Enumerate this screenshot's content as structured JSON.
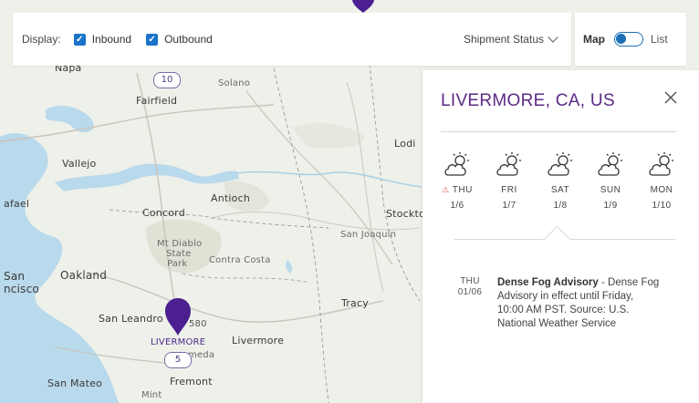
{
  "topbar": {
    "display_label": "Display:",
    "inbound_label": "Inbound",
    "outbound_label": "Outbound",
    "inbound_checked": true,
    "outbound_checked": true,
    "status_label": "Shipment Status"
  },
  "view_toggle": {
    "map_label": "Map",
    "list_label": "List",
    "active": "Map"
  },
  "map": {
    "places": {
      "napa": "Napa",
      "solano": "Solano",
      "fairfield": "Fairfield",
      "vallejo": "Vallejo",
      "rafael": "afael",
      "antioch": "Antioch",
      "concord": "Concord",
      "mt_diablo": "Mt Diablo",
      "state": "State",
      "park": "Park",
      "contra_costa": "Contra Costa",
      "oakland": "Oakland",
      "san": "San",
      "ncisco": "ncisco",
      "san_leandro": "San Leandro",
      "livermore": "Livermore",
      "tracy": "Tracy",
      "san_joaquin": "San Joaquin",
      "stockton": "Stockto",
      "lodi": "Lodi",
      "fremont": "Fremont",
      "san_mateo": "San Mateo",
      "meda": "meda",
      "minor": "Mint"
    },
    "shields": {
      "hwy10": "10",
      "hwy5": "5",
      "hwy580": "580"
    },
    "marker_label": "LIVERMORE",
    "colors": {
      "marker": "#4b1f8f",
      "water": "#b9d9ec",
      "land": "#eef0ea"
    }
  },
  "weather": {
    "title": "LIVERMORE, CA, US",
    "days": [
      {
        "name": "THU",
        "date": "1/6",
        "icon": "partly-cloudy-icon",
        "alert": true
      },
      {
        "name": "FRI",
        "date": "1/7",
        "icon": "partly-cloudy-icon",
        "alert": false
      },
      {
        "name": "SAT",
        "date": "1/8",
        "icon": "partly-cloudy-icon",
        "alert": false
      },
      {
        "name": "SUN",
        "date": "1/9",
        "icon": "partly-cloudy-icon",
        "alert": false
      },
      {
        "name": "MON",
        "date": "1/10",
        "icon": "partly-cloudy-icon",
        "alert": false
      }
    ],
    "alert": {
      "day": "THU",
      "date": "01/06",
      "headline": "Dense Fog Advisory",
      "separator": " - ",
      "body": "Dense Fog Advisory in effect until Friday, 10:00 AM PST. Source: U.S. National Weather Service"
    }
  }
}
